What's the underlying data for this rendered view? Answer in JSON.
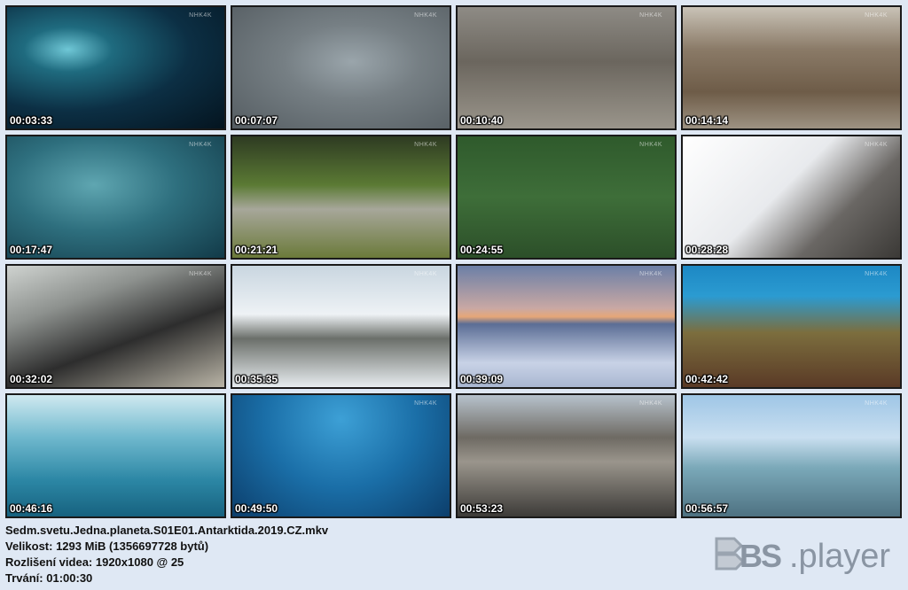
{
  "thumbnails": [
    {
      "time": "00:03:33",
      "watermark": "NHK4K",
      "bg": "radial-gradient(ellipse at 28% 35%, #6fc7d6 0%, #1f6b7f 20%, #0c2f44 55%, #04141f 100%)"
    },
    {
      "time": "00:07:07",
      "watermark": "NHK4K",
      "bg": "radial-gradient(ellipse at 55% 45%, #9aa5ab 0%, #767f84 40%, #555d62 100%)"
    },
    {
      "time": "00:10:40",
      "watermark": "NHK4K",
      "bg": "linear-gradient(180deg, #8e8b85 0%, #6b665e 45%, #9a958b 100%)"
    },
    {
      "time": "00:14:14",
      "watermark": "NHK4K",
      "bg": "linear-gradient(180deg, #c9c3b7 0%, #8a7a67 35%, #6e5c48 70%, #9d9282 100%)"
    },
    {
      "time": "00:17:47",
      "watermark": "NHK4K",
      "bg": "radial-gradient(ellipse at 40% 40%, #5fa6b1 0%, #2e6f7e 45%, #123a48 100%)"
    },
    {
      "time": "00:21:21",
      "watermark": "NHK4K",
      "bg": "linear-gradient(180deg, #2e3b22 0%, #5b7a34 40%, #a7a79a 60%, #6b7a3a 100%)"
    },
    {
      "time": "00:24:55",
      "watermark": "NHK4K",
      "bg": "linear-gradient(180deg, #2f5a2c 0%, #3e6e39 50%, #2c4f29 100%)"
    },
    {
      "time": "00:28:28",
      "watermark": "NHK4K",
      "bg": "linear-gradient(135deg, #ffffff 0%, #e8eaed 45%, #6a6764 70%, #3b3936 100%)"
    },
    {
      "time": "00:32:02",
      "watermark": "NHK4K",
      "bg": "linear-gradient(160deg, #cfd3d0 0%, #8d918e 30%, #2d2d2d 60%, #b9b4a6 100%)"
    },
    {
      "time": "00:35:35",
      "watermark": "NHK4K",
      "bg": "linear-gradient(180deg, #c9d6e0 0%, #eef2f5 40%, #6b6f6a 60%, #e7ecef 100%)"
    },
    {
      "time": "00:39:09",
      "watermark": "NHK4K",
      "bg": "linear-gradient(180deg, #6b7fa6 0%, #c9a8a4 35%, #e6a778 42%, #5b6d95 48%, #c8d2e6 80%, #a9b7d1 100%)"
    },
    {
      "time": "00:42:42",
      "watermark": "NHK4K",
      "bg": "linear-gradient(180deg, #1d88c4 0%, #2b9bd1 25%, #7c6e3e 55%, #5a3a26 100%)"
    },
    {
      "time": "00:46:16",
      "watermark": "",
      "bg": "linear-gradient(180deg, #cfe9f0 0%, #6fb8cd 35%, #2c87a5 70%, #17627f 100%)"
    },
    {
      "time": "00:49:50",
      "watermark": "NHK4K",
      "bg": "radial-gradient(ellipse at 50% 20%, #3da0d6 0%, #1a6ea7 50%, #0c3e6b 100%)"
    },
    {
      "time": "00:53:23",
      "watermark": "NHK4K",
      "bg": "linear-gradient(180deg, #b7c2cc 0%, #6e6a63 35%, #9a958c 55%, #3d3b38 100%)"
    },
    {
      "time": "00:56:57",
      "watermark": "NHK4K",
      "bg": "linear-gradient(180deg, #9fc6e6 0%, #c9dff0 35%, #7aa8b8 60%, #4e7282 100%)"
    }
  ],
  "info": {
    "filename": "Sedm.svetu.Jedna.planeta.S01E01.Antarktida.2019.CZ.mkv",
    "size": "Velikost: 1293 MiB (1356697728 bytů)",
    "resolution": "Rozlišení videa: 1920x1080 @ 25",
    "duration": "Trvání: 01:00:30"
  },
  "logo": {
    "text": ".player",
    "bs_letters": "BS",
    "color": "#8a95a3"
  }
}
